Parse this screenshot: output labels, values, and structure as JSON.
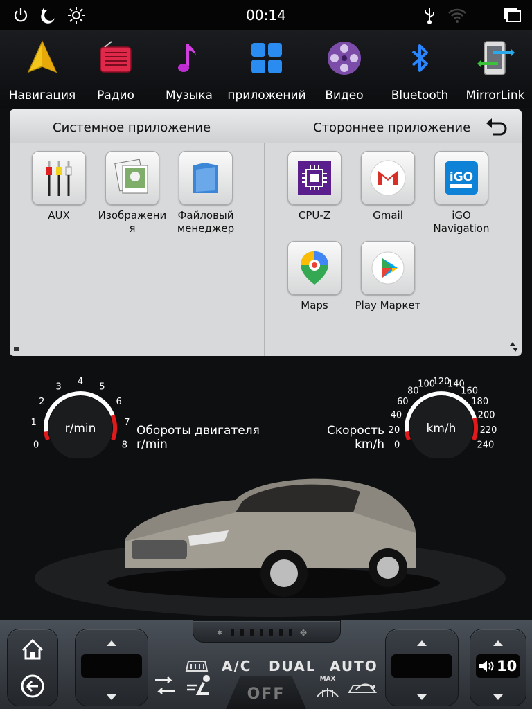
{
  "status": {
    "time": "00:14"
  },
  "dock": [
    {
      "label": "Навигация",
      "icon": "navigation-arrow-icon"
    },
    {
      "label": "Радио",
      "icon": "radio-icon"
    },
    {
      "label": "Музыка",
      "icon": "music-note-icon"
    },
    {
      "label": "приложений",
      "icon": "apps-grid-icon"
    },
    {
      "label": "Видео",
      "icon": "video-reel-icon"
    },
    {
      "label": "Bluetooth",
      "icon": "bluetooth-icon"
    },
    {
      "label": "MirrorLink",
      "icon": "mirrorlink-icon"
    }
  ],
  "panel": {
    "system_title": "Системное приложение",
    "third_party_title": "Стороннее приложение",
    "system_apps": [
      {
        "line1": "AUX",
        "line2": "",
        "icon": "aux-cables-icon"
      },
      {
        "line1": "Изображени",
        "line2": "я",
        "icon": "gallery-icon"
      },
      {
        "line1": "Файловый",
        "line2": "менеджер",
        "icon": "folder-icon"
      }
    ],
    "third_party_apps": [
      {
        "line1": "CPU-Z",
        "line2": "",
        "icon": "cpu-chip-icon"
      },
      {
        "line1": "Gmail",
        "line2": "",
        "icon": "gmail-icon"
      },
      {
        "line1": "iGO",
        "line2": "Navigation",
        "icon": "igo-navigation-icon"
      },
      {
        "line1": "Maps",
        "line2": "",
        "icon": "maps-pin-icon"
      },
      {
        "line1": "Play Маркет",
        "line2": "",
        "icon": "play-store-icon"
      }
    ]
  },
  "gauges": {
    "rpm": {
      "unit": "r/min",
      "label_line1": "Обороты двигателя",
      "label_line2": "r/min",
      "ticks": [
        "0",
        "1",
        "2",
        "3",
        "4",
        "5",
        "6",
        "7",
        "8"
      ],
      "redline_from": 6.5
    },
    "speed": {
      "unit": "km/h",
      "label_line1": "Скорость",
      "label_line2": "km/h",
      "ticks": [
        "0",
        "20",
        "40",
        "60",
        "80",
        "100",
        "120",
        "140",
        "160",
        "180",
        "200",
        "220",
        "240"
      ],
      "redline_from": 200
    }
  },
  "bottom": {
    "ac_label": "A/C",
    "dual_label": "DUAL",
    "auto_label": "AUTO",
    "off_label": "OFF",
    "max_label": "MAX",
    "volume": "10"
  }
}
